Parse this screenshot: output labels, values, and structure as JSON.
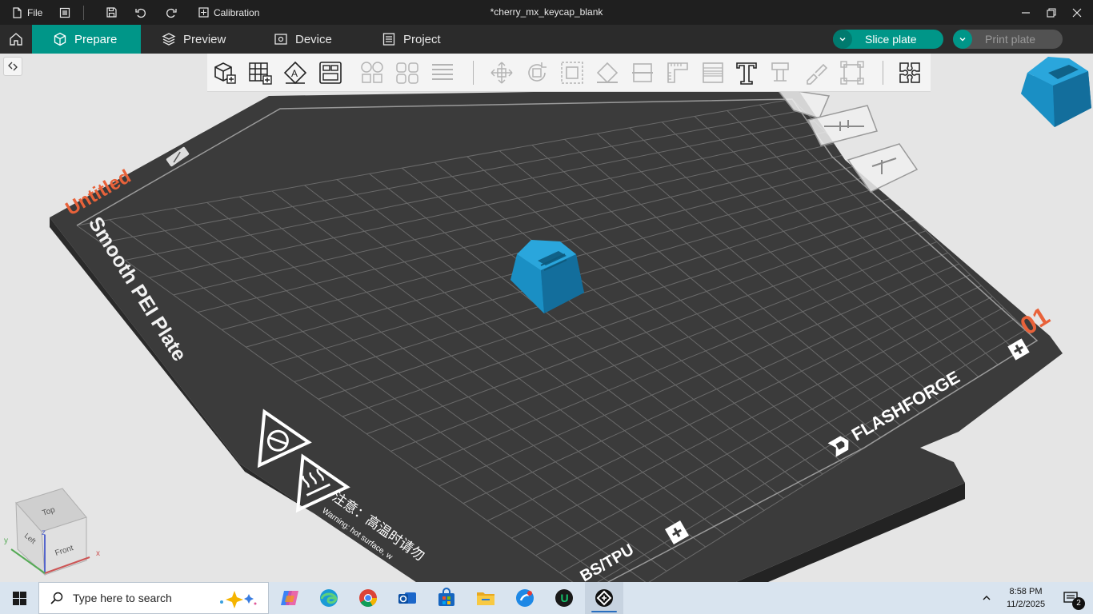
{
  "window": {
    "title": "*cherry_mx_keycap_blank",
    "menu_file": "File",
    "calibration": "Calibration"
  },
  "tabs": [
    {
      "label": "Prepare",
      "active": true
    },
    {
      "label": "Preview",
      "active": false
    },
    {
      "label": "Device",
      "active": false
    },
    {
      "label": "Project",
      "active": false
    }
  ],
  "actions": {
    "slice_plate": "Slice plate",
    "print_plate": "Print plate"
  },
  "plate": {
    "name": "Untitled",
    "surface": "Smooth PEI Plate",
    "number": "01",
    "brand": "FLASHFORGE",
    "material_text": "BS/TPU",
    "warning_cn": "注意：高温时请勿",
    "warning_en": "Warning: hot surface, w"
  },
  "view_cube": {
    "top": "Top",
    "front": "Front",
    "left": "Left",
    "axis_x": "x",
    "axis_y": "y",
    "axis_z": "z"
  },
  "taskbar": {
    "search_placeholder": "Type here to search",
    "time": "8:58 PM",
    "date": "11/2/2025",
    "notification_count": "2"
  },
  "colors": {
    "accent": "#009688",
    "model": "#1a8fc4",
    "plate": "#3b3b3b",
    "plate_label": "#e8623a"
  },
  "icons": {
    "add-cube": "add-cube-icon",
    "arrange": "arrange-grid-icon",
    "auto-orient": "auto-orient-icon",
    "plate-settings": "plate-settings-icon",
    "split-objects": "split-objects-icon",
    "split-parts": "split-parts-icon",
    "layers": "layers-icon",
    "move": "move-icon",
    "rotate": "rotate-icon",
    "scale": "scale-icon",
    "lay-on-face": "lay-on-face-icon",
    "cut": "cut-icon",
    "measure": "measure-icon",
    "variable-layer": "variable-layer-icon",
    "text": "text-icon",
    "support-paint": "support-paint-icon",
    "seam-paint": "seam-paint-icon",
    "assembly": "assembly-icon",
    "puzzle": "puzzle-icon"
  }
}
